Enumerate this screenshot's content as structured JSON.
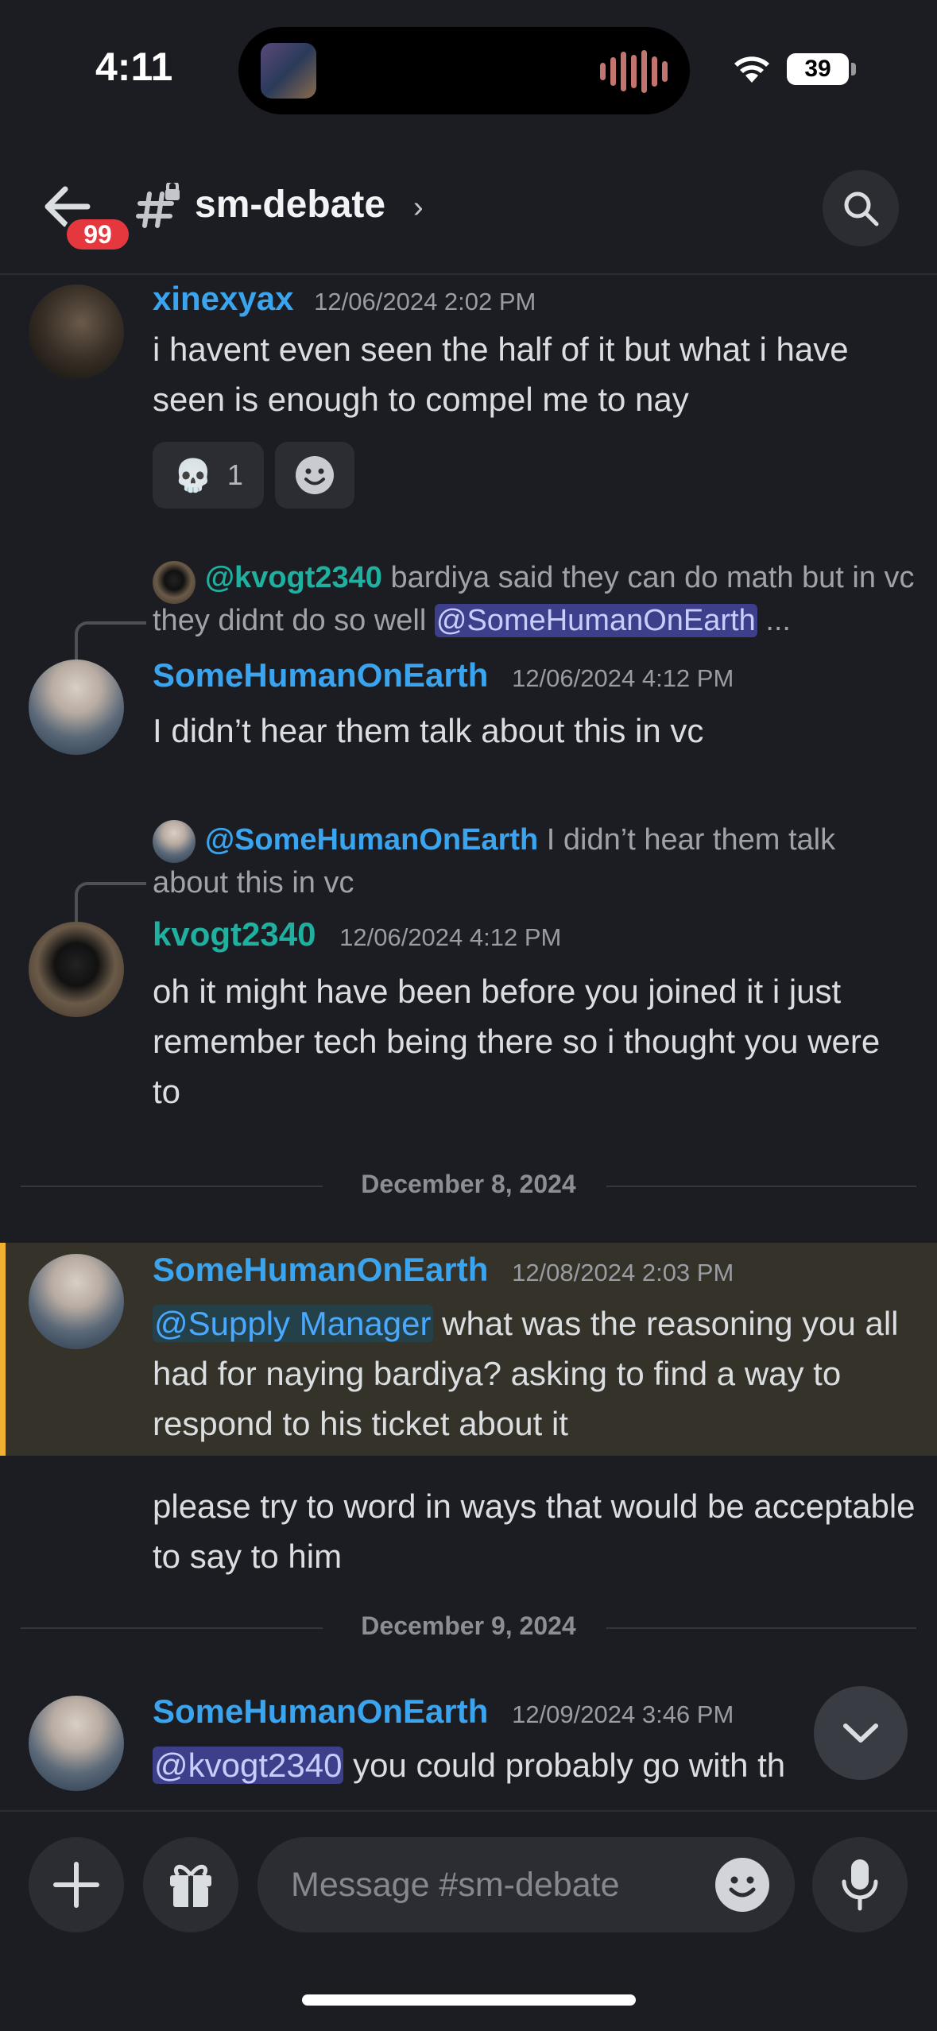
{
  "status": {
    "time": "4:11",
    "battery": "39"
  },
  "header": {
    "unread_count": "99",
    "channel_name": "sm-debate",
    "chevron": "›"
  },
  "messages": [
    {
      "username": "xinexyax",
      "timestamp": "12/06/2024 2:02 PM",
      "text": "i havent even seen the half of it but what i have seen is enough to compel me to nay",
      "reactions": [
        {
          "emoji": "💀",
          "count": "1"
        }
      ]
    },
    {
      "reply": {
        "user": "@kvogt2340",
        "text_a": "bardiya said they can do math but in vc they didnt do so well",
        "mention": "@SomeHumanOnEarth",
        "ellipsis": "..."
      },
      "username": "SomeHumanOnEarth",
      "timestamp": "12/06/2024 4:12 PM",
      "text": "I didn’t hear them talk about this in vc"
    },
    {
      "reply": {
        "user": "@SomeHumanOnEarth",
        "text": "I didn’t hear them talk about this in vc"
      },
      "username": "kvogt2340",
      "timestamp": "12/06/2024 4:12 PM",
      "text": "oh it might have been before you joined it i just remember tech being there so i thought you were to"
    },
    {
      "username": "SomeHumanOnEarth",
      "timestamp": "12/08/2024 2:03 PM",
      "mention": "@Supply Manager",
      "text": "what was the reasoning you all had for naying bardiya? asking to find a way to respond to his ticket about it",
      "followup": "please try to word in ways that would be acceptable to say to him"
    },
    {
      "username": "SomeHumanOnEarth",
      "timestamp": "12/09/2024 3:46 PM",
      "mention": "@kvogt2340",
      "text": "you could probably go with th"
    }
  ],
  "dividers": {
    "first": "December 8, 2024",
    "second": "December 9, 2024"
  },
  "composer": {
    "placeholder": "Message #sm-debate"
  },
  "icons": {
    "back": "arrow-left-icon",
    "channel": "hashtag-lock-icon",
    "search": "search-icon",
    "add": "plus-icon",
    "gift": "gift-icon",
    "emoji": "emoji-icon",
    "mic": "microphone-icon",
    "scroll": "chevron-down-icon"
  },
  "colors": {
    "accent_blue": "#3aa4ef",
    "accent_teal": "#1fb0a0",
    "badge_red": "#e5383e",
    "highlight_bar": "#f0b132"
  }
}
